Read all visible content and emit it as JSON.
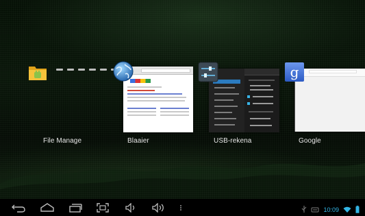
{
  "recent_apps": [
    {
      "label": "File Manage",
      "icon": "folder-icon"
    },
    {
      "label": "Blaaier",
      "icon": "globe-icon"
    },
    {
      "label": "USB-rekena",
      "icon": "settings-sliders-icon"
    },
    {
      "label": "Google",
      "icon": "google-g-icon"
    }
  ],
  "status_bar": {
    "time": "10:09"
  },
  "nav_bar": {
    "buttons": [
      "back-icon",
      "home-icon",
      "recent-apps-icon",
      "screenshot-icon",
      "volume-down-icon",
      "volume-up-icon",
      "more-icon"
    ]
  },
  "colors": {
    "accent": "#33b5e5",
    "google_blue": "#3f6fd8",
    "selection": "#2b7bbf"
  }
}
